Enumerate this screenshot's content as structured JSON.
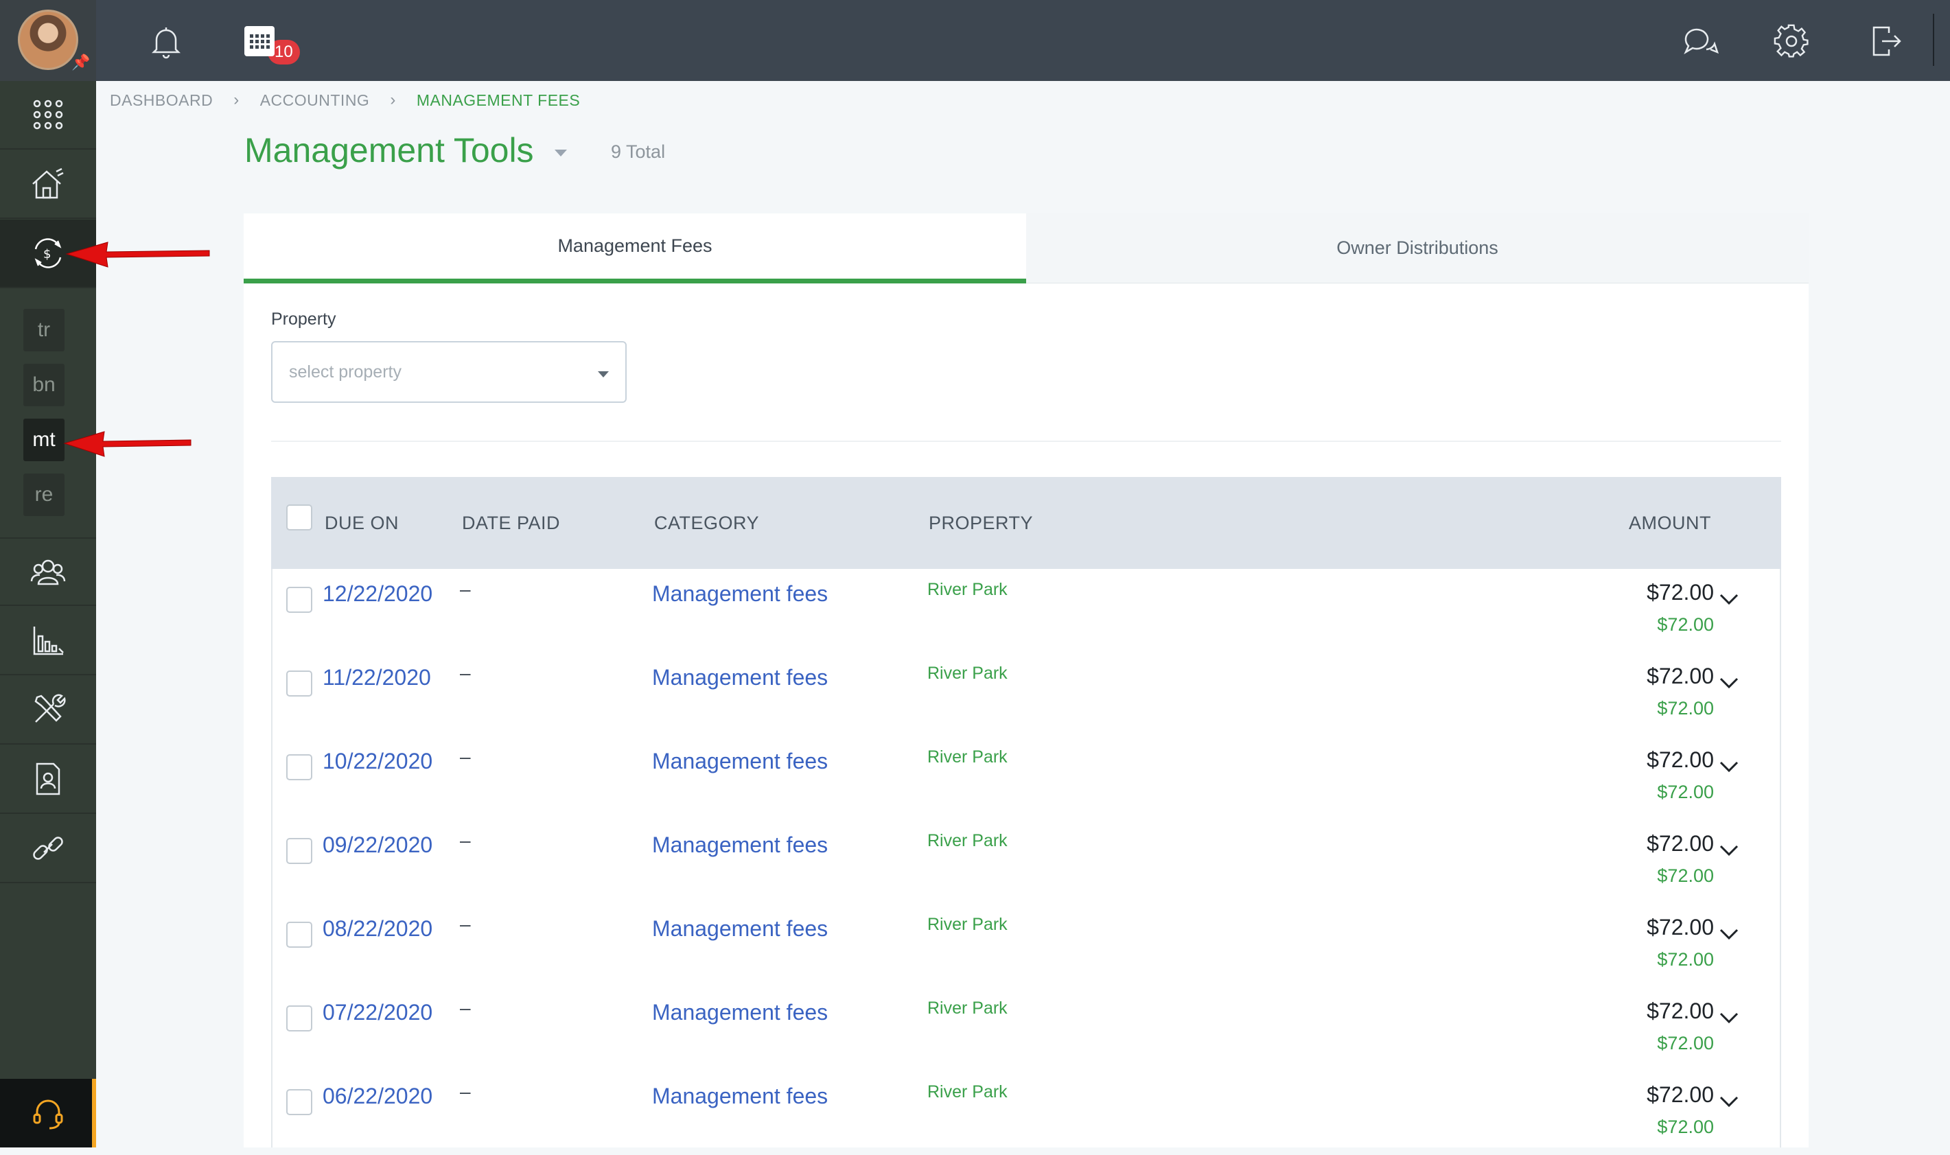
{
  "topbar": {
    "notification_count": "10"
  },
  "sidebar": {
    "items": [
      "apps-grid-icon",
      "properties-icon",
      "accounting-icon",
      "contacts-icon",
      "reports-icon",
      "maintenance-icon",
      "documents-icon",
      "links-icon"
    ],
    "subitems": [
      {
        "label": "tr",
        "active": false
      },
      {
        "label": "bn",
        "active": false
      },
      {
        "label": "mt",
        "active": true
      },
      {
        "label": "re",
        "active": false
      }
    ]
  },
  "breadcrumb": {
    "items": [
      "DASHBOARD",
      "ACCOUNTING",
      "MANAGEMENT FEES"
    ]
  },
  "page": {
    "title": "Management Tools",
    "total": "9 Total"
  },
  "tabs": {
    "management_fees": "Management Fees",
    "owner_distributions": "Owner Distributions"
  },
  "filter": {
    "label": "Property",
    "placeholder": "select property"
  },
  "table": {
    "headers": {
      "due_on": "DUE ON",
      "date_paid": "DATE PAID",
      "category": "CATEGORY",
      "property": "PROPERTY",
      "amount": "AMOUNT"
    },
    "rows": [
      {
        "due_on": "12/22/2020",
        "date_paid": "–",
        "category": "Management fees",
        "property": "River Park",
        "amount": "$72.00",
        "amount_paid": "$72.00"
      },
      {
        "due_on": "11/22/2020",
        "date_paid": "–",
        "category": "Management fees",
        "property": "River Park",
        "amount": "$72.00",
        "amount_paid": "$72.00"
      },
      {
        "due_on": "10/22/2020",
        "date_paid": "–",
        "category": "Management fees",
        "property": "River Park",
        "amount": "$72.00",
        "amount_paid": "$72.00"
      },
      {
        "due_on": "09/22/2020",
        "date_paid": "–",
        "category": "Management fees",
        "property": "River Park",
        "amount": "$72.00",
        "amount_paid": "$72.00"
      },
      {
        "due_on": "08/22/2020",
        "date_paid": "–",
        "category": "Management fees",
        "property": "River Park",
        "amount": "$72.00",
        "amount_paid": "$72.00"
      },
      {
        "due_on": "07/22/2020",
        "date_paid": "–",
        "category": "Management fees",
        "property": "River Park",
        "amount": "$72.00",
        "amount_paid": "$72.00"
      },
      {
        "due_on": "06/22/2020",
        "date_paid": "–",
        "category": "Management fees",
        "property": "River Park",
        "amount": "$72.00",
        "amount_paid": "$72.00"
      }
    ]
  },
  "colors": {
    "accent_green": "#3aa04a",
    "link_blue": "#3a63c2",
    "sidebar": "#333d35",
    "topbar": "#3d4650",
    "annotation_arrow": "#e01010"
  }
}
